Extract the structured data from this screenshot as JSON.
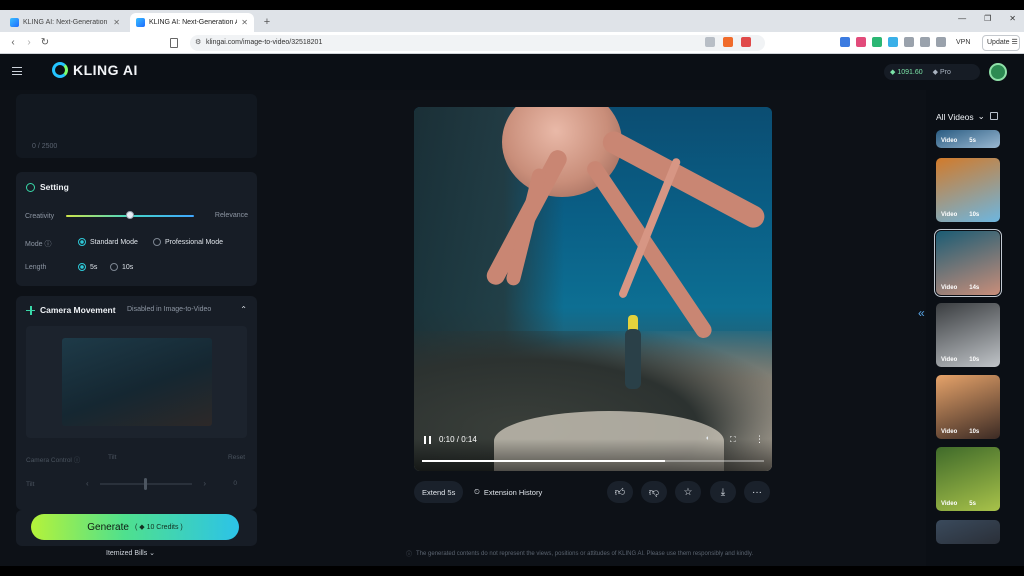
{
  "browser": {
    "tabs": [
      {
        "title": "KLING AI: Next-Generation AI Creat",
        "active": false
      },
      {
        "title": "KLING AI: Next-Generation AI Cre",
        "active": true
      }
    ],
    "url": "klingai.com/image-to-video/32518201",
    "vpn_label": "VPN",
    "update_label": "Update"
  },
  "app": {
    "logo_text": "KLING AI",
    "credits": "1091.60",
    "plan": "Pro"
  },
  "prompt": {
    "counter": "0 / 2500"
  },
  "setting": {
    "title": "Setting",
    "creativity_label": "Creativity",
    "relevance_label": "Relevance",
    "slider_value": 0.5,
    "mode_label": "Mode",
    "mode_options": [
      "Standard Mode",
      "Professional Mode"
    ],
    "mode_selected": "Standard Mode",
    "length_label": "Length",
    "length_options": [
      "5s",
      "10s"
    ],
    "length_selected": "5s"
  },
  "camera": {
    "title": "Camera Movement",
    "note": "Disabled in Image-to-Video",
    "control_label": "Camera Control",
    "control_option": "Tilt",
    "control_more": "Reset",
    "tilt_label": "Tilt",
    "tilt_value": "0"
  },
  "generate": {
    "label": "Generate",
    "credits": "10 Credits",
    "bills": "Itemized Bills"
  },
  "player": {
    "time": "0:10 / 0:14",
    "progress": 0.71
  },
  "actions": {
    "extend": "Extend 5s",
    "history": "Extension History"
  },
  "disclaimer": "The generated contents do not represent the views, positions or attitudes of KLING AI. Please use them responsibly and kindly.",
  "sidebar": {
    "title": "All Videos",
    "items": [
      {
        "kind": "Video",
        "duration": "5s",
        "colors": [
          "#2a5c82",
          "#9bb9d2"
        ]
      },
      {
        "kind": "Video",
        "duration": "10s",
        "colors": [
          "#d27a2a",
          "#6db6e0"
        ]
      },
      {
        "kind": "Video",
        "duration": "14s",
        "colors": [
          "#1b5c74",
          "#c98e7a"
        ],
        "selected": true
      },
      {
        "kind": "Video",
        "duration": "10s",
        "colors": [
          "#3a3d40",
          "#c0c4c8"
        ]
      },
      {
        "kind": "Video",
        "duration": "10s",
        "colors": [
          "#e6a36a",
          "#3b2a24"
        ]
      },
      {
        "kind": "Video",
        "duration": "5s",
        "colors": [
          "#3f6a2a",
          "#a8c24a"
        ]
      },
      {
        "kind": "",
        "duration": "",
        "colors": [
          "#3a4a5c",
          "#2a2f38"
        ]
      }
    ]
  },
  "colors": {
    "accent": "#2ec9d8",
    "generate_start": "#b5f23a",
    "generate_end": "#2cc3e8"
  }
}
